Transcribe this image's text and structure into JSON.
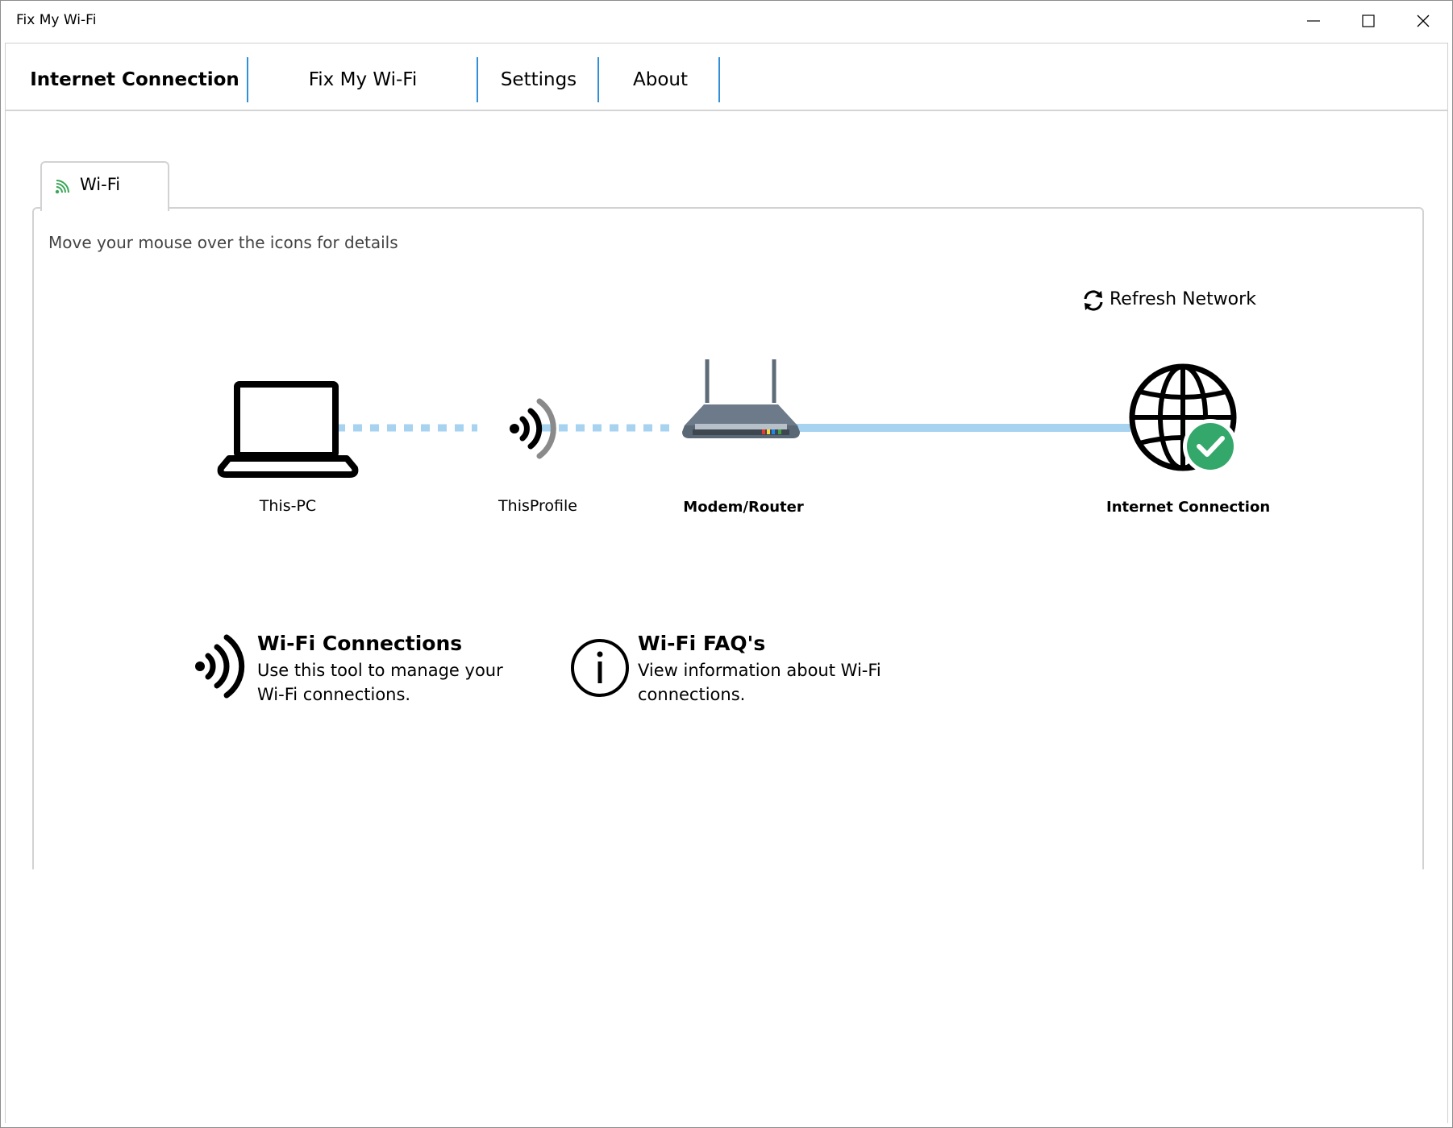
{
  "window": {
    "title": "Fix My Wi-Fi",
    "controls": [
      "minimize-icon",
      "maximize-icon",
      "close-icon"
    ]
  },
  "nav": {
    "items": [
      {
        "label": "Internet Connection",
        "active": true
      },
      {
        "label": "Fix My Wi-Fi",
        "active": false
      },
      {
        "label": "Settings",
        "active": false
      },
      {
        "label": "About",
        "active": false
      }
    ],
    "separator_color": "#2f8fd8"
  },
  "tab": {
    "label": "Wi-Fi",
    "icon": "wifi-signal-icon",
    "icon_color": "#3aa757"
  },
  "panel": {
    "hint": "Move your mouse over the icons for details",
    "refresh_label": "Refresh Network"
  },
  "diagram": {
    "devices": [
      {
        "label": "This-PC",
        "icon": "laptop-icon"
      },
      {
        "label": "ThisProfile",
        "icon": "wireless-signal-icon"
      },
      {
        "label": "Modem/Router",
        "icon": "router-icon"
      },
      {
        "label": "Internet Connection",
        "icon": "globe-check-icon",
        "status": "connected"
      }
    ],
    "link_color": "#a7d3f0",
    "status_color": "#34a86a"
  },
  "cards": [
    {
      "title": "Wi-Fi Connections",
      "description": "Use this tool to manage your Wi-Fi connections.",
      "icon": "wireless-signal-icon"
    },
    {
      "title": "Wi-Fi FAQ's",
      "description": "View information about Wi-Fi connections.",
      "icon": "info-circle-icon"
    }
  ]
}
